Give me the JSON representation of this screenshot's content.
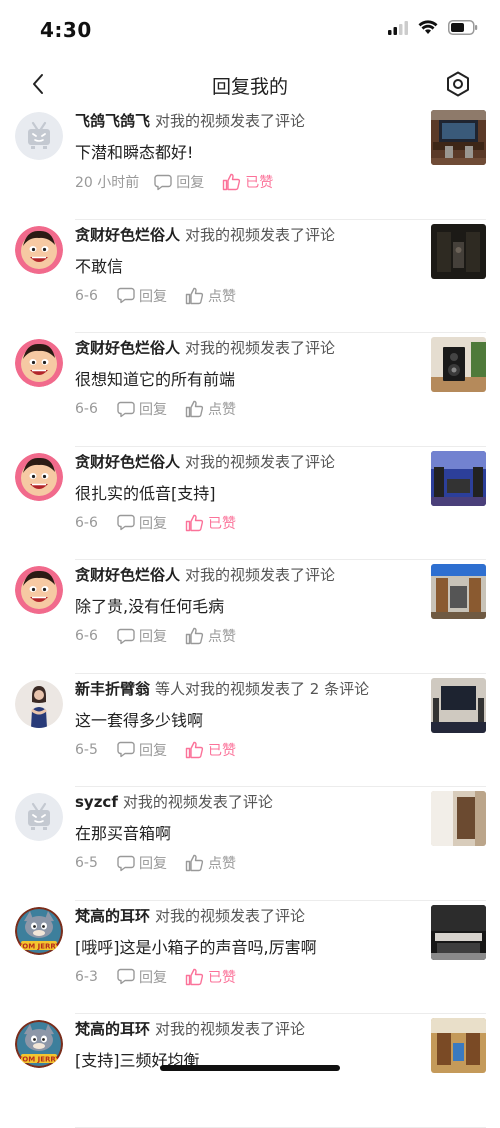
{
  "status": {
    "time": "4:30"
  },
  "nav": {
    "title": "回复我的"
  },
  "colors": {
    "accent": "#fb7299",
    "meta": "#999999"
  },
  "items": [
    {
      "user": "飞鸽飞鸽飞",
      "action": "对我的视频发表了评论",
      "comment": "下潜和瞬态都好!",
      "time": "20 小时前",
      "reply": "回复",
      "like": "已赞",
      "liked": true,
      "avatar": "tv-placeholder"
    },
    {
      "user": "贪财好色烂俗人",
      "action": "对我的视频发表了评论",
      "comment": "不敢信",
      "time": "6-6",
      "reply": "回复",
      "like": "点赞",
      "liked": false,
      "avatar": "cartoon"
    },
    {
      "user": "贪财好色烂俗人",
      "action": "对我的视频发表了评论",
      "comment": "很想知道它的所有前端",
      "time": "6-6",
      "reply": "回复",
      "like": "点赞",
      "liked": false,
      "avatar": "cartoon"
    },
    {
      "user": "贪财好色烂俗人",
      "action": "对我的视频发表了评论",
      "comment": "很扎实的低音[支持]",
      "time": "6-6",
      "reply": "回复",
      "like": "已赞",
      "liked": true,
      "avatar": "cartoon"
    },
    {
      "user": "贪财好色烂俗人",
      "action": "对我的视频发表了评论",
      "comment": "除了贵,没有任何毛病",
      "time": "6-6",
      "reply": "回复",
      "like": "点赞",
      "liked": false,
      "avatar": "cartoon"
    },
    {
      "user": "新丰折臂翁",
      "action": "等人对我的视频发表了 2 条评论",
      "comment": "这一套得多少钱啊",
      "time": "6-5",
      "reply": "回复",
      "like": "已赞",
      "liked": true,
      "avatar": "person"
    },
    {
      "user": "syzcf",
      "action": "对我的视频发表了评论",
      "comment": "在那买音箱啊",
      "time": "6-5",
      "reply": "回复",
      "like": "点赞",
      "liked": false,
      "avatar": "tv-placeholder"
    },
    {
      "user": "梵高的耳环",
      "action": "对我的视频发表了评论",
      "comment": "[哦呼]这是小箱子的声音吗,厉害啊",
      "time": "6-3",
      "reply": "回复",
      "like": "已赞",
      "liked": true,
      "avatar": "tom"
    },
    {
      "user": "梵高的耳环",
      "action": "对我的视频发表了评论",
      "comment": "[支持]三频好均衡",
      "time": "",
      "reply": "",
      "like": "",
      "liked": false,
      "avatar": "tom"
    }
  ]
}
